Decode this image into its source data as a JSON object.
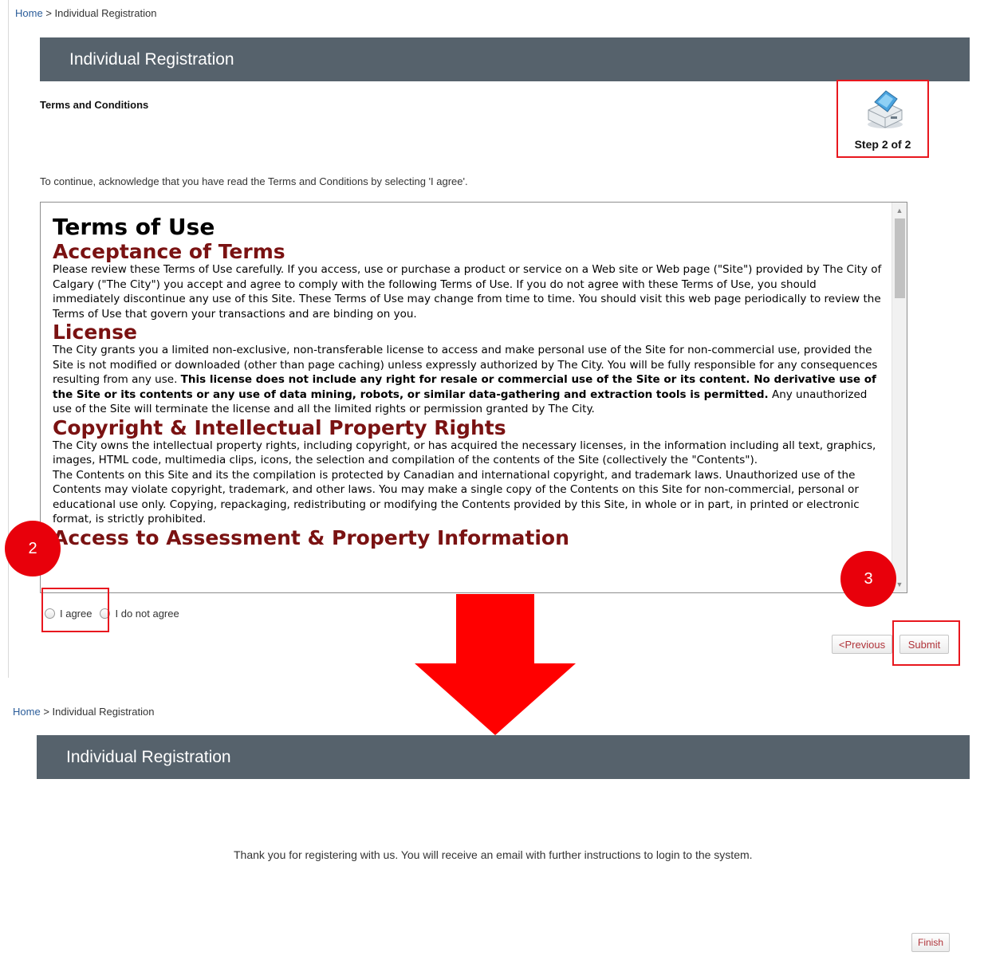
{
  "step1": {
    "breadcrumb": {
      "home": "Home",
      "separator": ">",
      "current": "Individual Registration"
    },
    "title": "Individual Registration",
    "section_label": "Terms and Conditions",
    "step_label": "Step 2 of 2",
    "step_icon": "printer-icon",
    "instructions": "To continue, acknowledge that you have read the Terms and Conditions by selecting 'I agree'.",
    "terms": {
      "heading": "Terms of Use",
      "acceptance_heading": "Acceptance of Terms",
      "acceptance_text": "Please review these Terms of Use carefully. If you access, use or purchase a product or service on a Web site or Web page (\"Site\") provided by The City of Calgary (\"The City\") you accept and agree to comply with the following Terms of Use. If you do not agree with these Terms of Use, you should immediately discontinue any use of this Site. These Terms of Use may change from time to time. You should visit this web page periodically to review the Terms of Use that govern your transactions and are binding on you.",
      "license_heading": "License",
      "license_text_1": "The City grants you a limited non-exclusive, non-transferable license to access and make personal use of the Site for non-commercial use, provided the Site is not modified or downloaded (other than page caching) unless expressly authorized by The City. You will be fully responsible for any consequences resulting from any use.",
      "license_text_bold": "This license does not include any right for resale or commercial use of the Site or its content. No derivative use of the Site or its contents or any use of data mining, robots, or similar data-gathering and extraction tools is permitted.",
      "license_text_2": "Any unauthorized use of the Site will terminate the license and all the limited rights or permission granted by The City.",
      "copyright_heading": "Copyright & Intellectual Property Rights",
      "copyright_text_1": "The City owns the intellectual property rights, including copyright, or has acquired the necessary licenses, in the information including all text, graphics, images, HTML code, multimedia clips, icons, the selection and compilation of the contents of the Site (collectively the \"Contents\").",
      "copyright_text_2": "The Contents on this Site and its the compilation is protected by Canadian and international copyright, and trademark laws. Unauthorized use of the Contents may violate copyright, trademark, and other laws. You may make a single copy of the Contents on this Site for non-commercial, personal or educational use only. Copying, repackaging, redistributing or modifying the Contents provided by this Site, in whole or in part, in printed or electronic format, is strictly prohibited.",
      "access_heading": "Access to Assessment & Property Information"
    },
    "options": {
      "agree": "I agree",
      "disagree": "I do not agree"
    },
    "buttons": {
      "previous": "<Previous",
      "submit": "Submit"
    },
    "callouts": {
      "agree_number": "2",
      "submit_number": "3"
    }
  },
  "step2": {
    "breadcrumb": {
      "home": "Home",
      "separator": ">",
      "current": "Individual Registration"
    },
    "title": "Individual Registration",
    "message": "Thank you for registering with us. You will receive an email with further instructions to login to the system.",
    "buttons": {
      "finish": "Finish"
    }
  },
  "colors": {
    "titlebar": "#56626c",
    "highlight": "#e8171e",
    "arrow": "#ff0000",
    "heading_red": "#7a1212",
    "button_text": "#b0343a",
    "link": "#2b5d9a"
  }
}
